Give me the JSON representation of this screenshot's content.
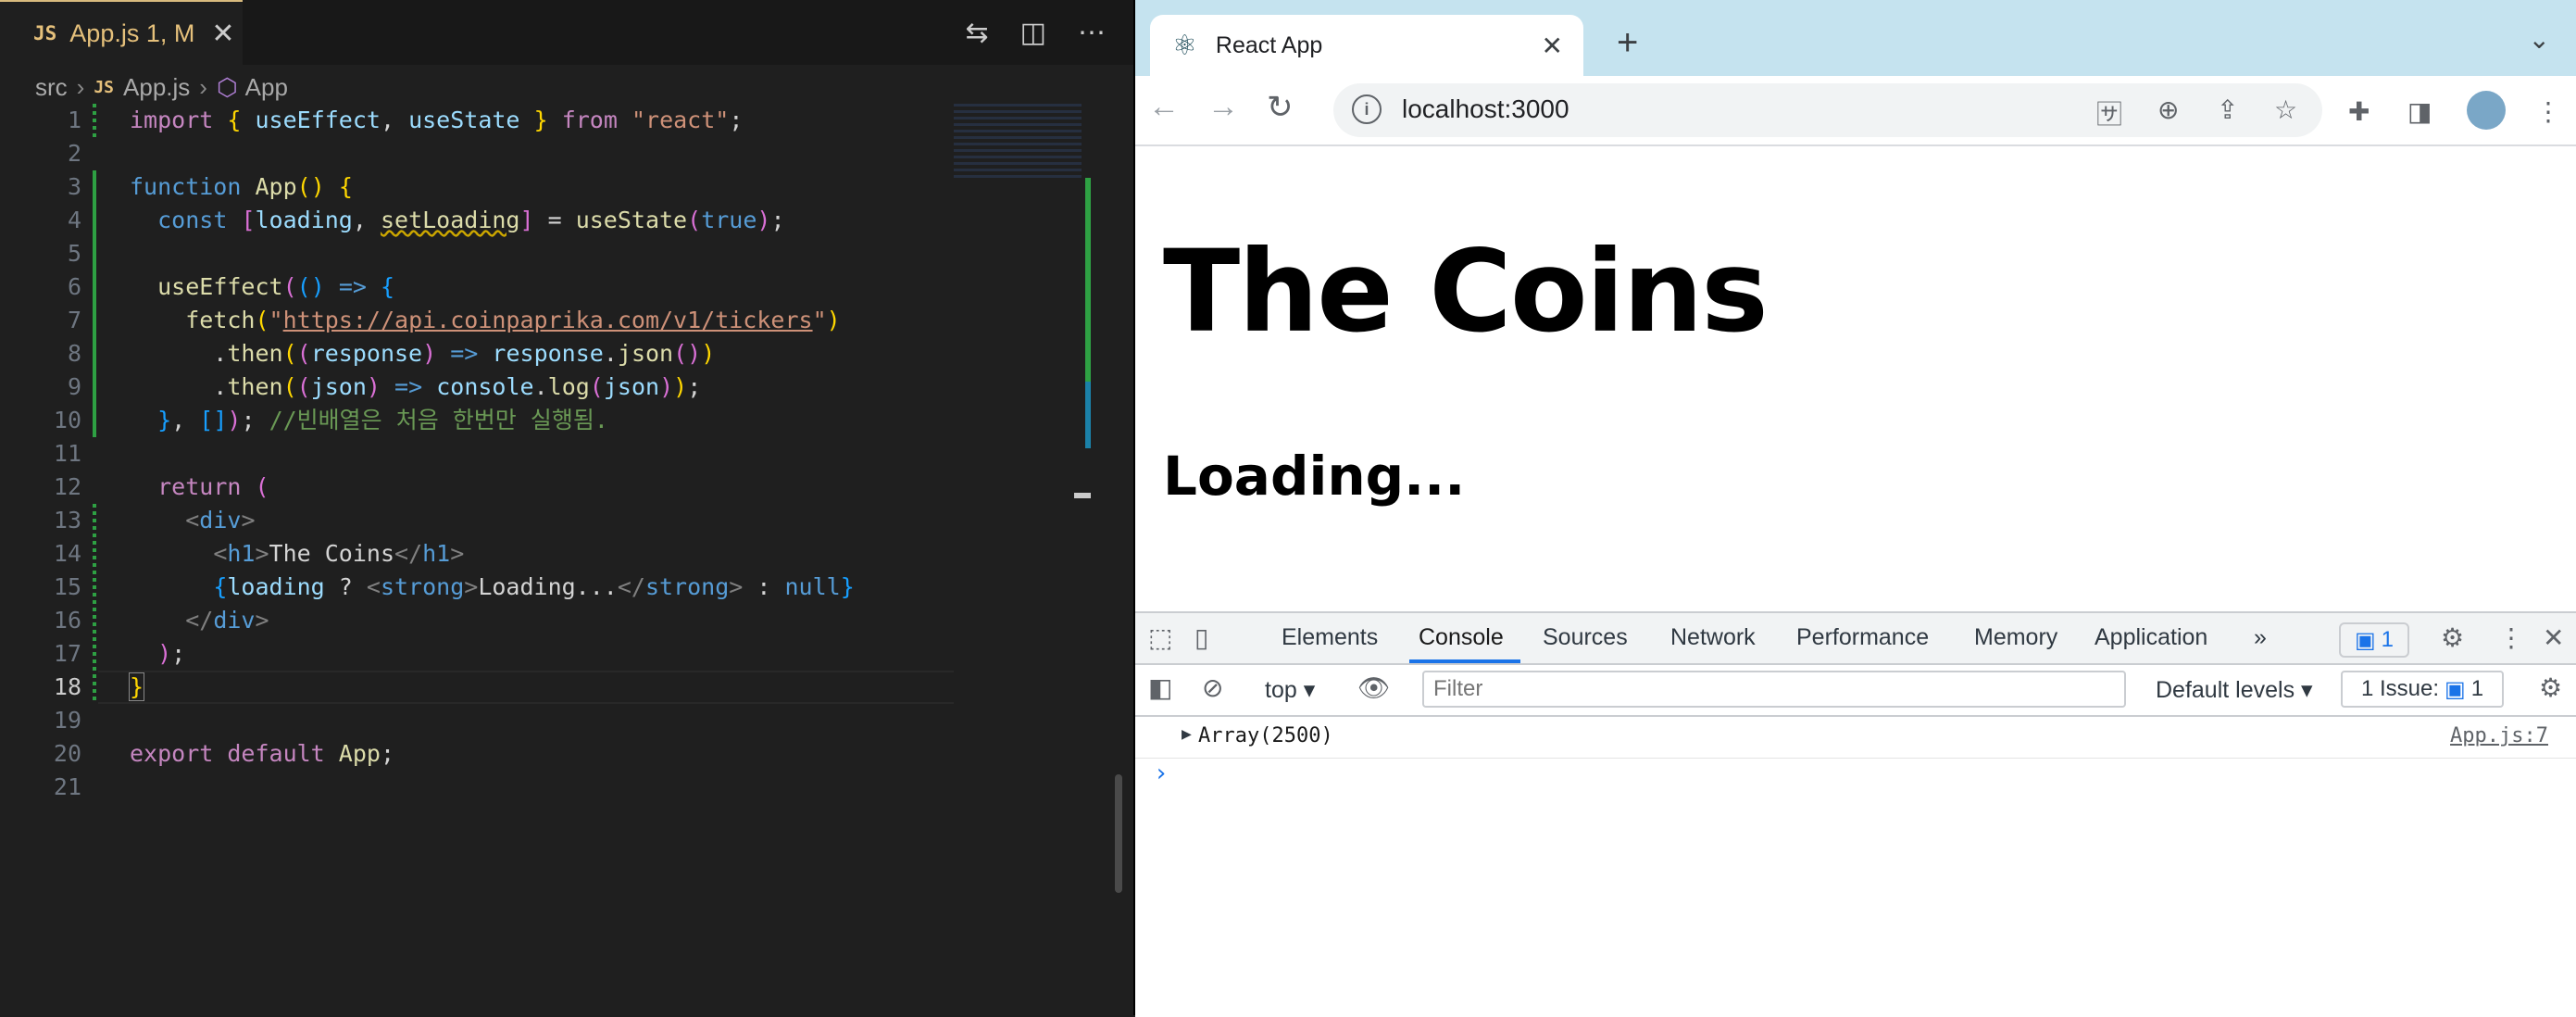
{
  "vscode": {
    "tab": {
      "badge": "JS",
      "label": "App.js 1, M",
      "close": "✕"
    },
    "actions": [
      "⇆",
      "◫",
      "⋯"
    ],
    "breadcrumbs": {
      "folder": "src",
      "file_badge": "JS",
      "file": "App.js",
      "symbol_icon": "⬡",
      "symbol": "App",
      "sep": "›"
    },
    "line_numbers": [
      "1",
      "2",
      "3",
      "4",
      "5",
      "6",
      "7",
      "8",
      "9",
      "10",
      "11",
      "12",
      "13",
      "14",
      "15",
      "16",
      "17",
      "18",
      "19",
      "20",
      "21"
    ]
  },
  "browser": {
    "tab_title": "React App",
    "tab_close": "✕",
    "new_tab": "+",
    "tab_menu": "⌄",
    "url": "localhost:3000",
    "info_icon": "i",
    "nav": {
      "back": "←",
      "forward": "→",
      "reload": "↻"
    },
    "page": {
      "heading": "The Coins",
      "strong": "Loading..."
    }
  },
  "devtools": {
    "tabs": [
      "Elements",
      "Console",
      "Sources",
      "Network",
      "Performance",
      "Memory",
      "Application"
    ],
    "more_tabs": "»",
    "message_count": "1",
    "context": "top",
    "filter_placeholder": "Filter",
    "levels": "Default levels",
    "issues_label": "1 Issue:",
    "issues_count": "1",
    "log": {
      "toggle": "▶",
      "text": "Array(2500)",
      "source": "App.js:7"
    },
    "prompt": "›"
  },
  "colors": {
    "accent": "#1a73e8",
    "tab_strip": "#c5e3ef",
    "editor_bg": "#1f1f1f"
  }
}
